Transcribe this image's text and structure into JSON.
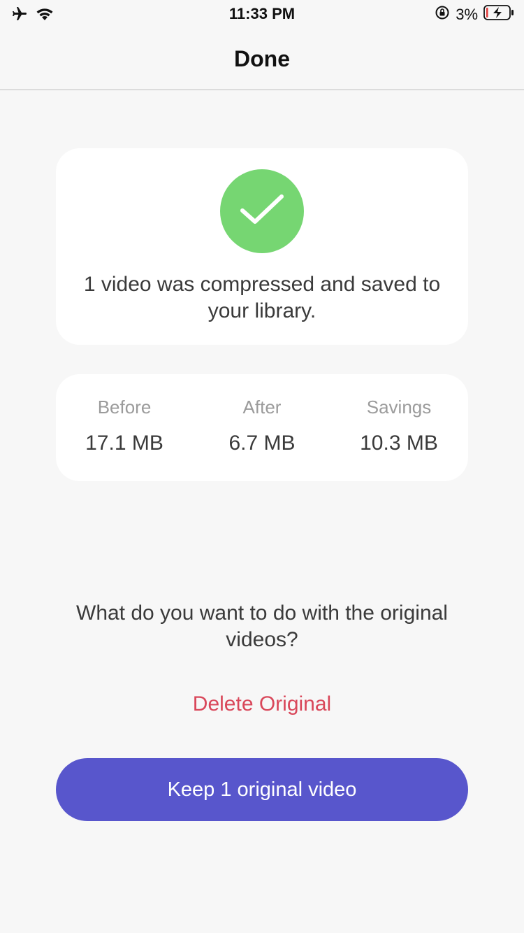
{
  "status_bar": {
    "time": "11:33 PM",
    "battery_percent": "3%",
    "icons": [
      "airplane-icon",
      "wifi-icon",
      "orientation-lock-icon",
      "battery-charging-icon"
    ]
  },
  "nav": {
    "title": "Done"
  },
  "success": {
    "icon": "checkmark-icon",
    "color": "#76d672",
    "message": "1 video was compressed and saved to your library."
  },
  "stats": [
    {
      "label": "Before",
      "value": "17.1 MB"
    },
    {
      "label": "After",
      "value": "6.7 MB"
    },
    {
      "label": "Savings",
      "value": "10.3 MB"
    }
  ],
  "question": "What do you want to do with the original videos?",
  "delete_label": "Delete Original",
  "keep_label": "Keep 1 original video",
  "colors": {
    "accent": "#5856cc",
    "destructive": "#d9475a",
    "background": "#f7f7f7"
  }
}
